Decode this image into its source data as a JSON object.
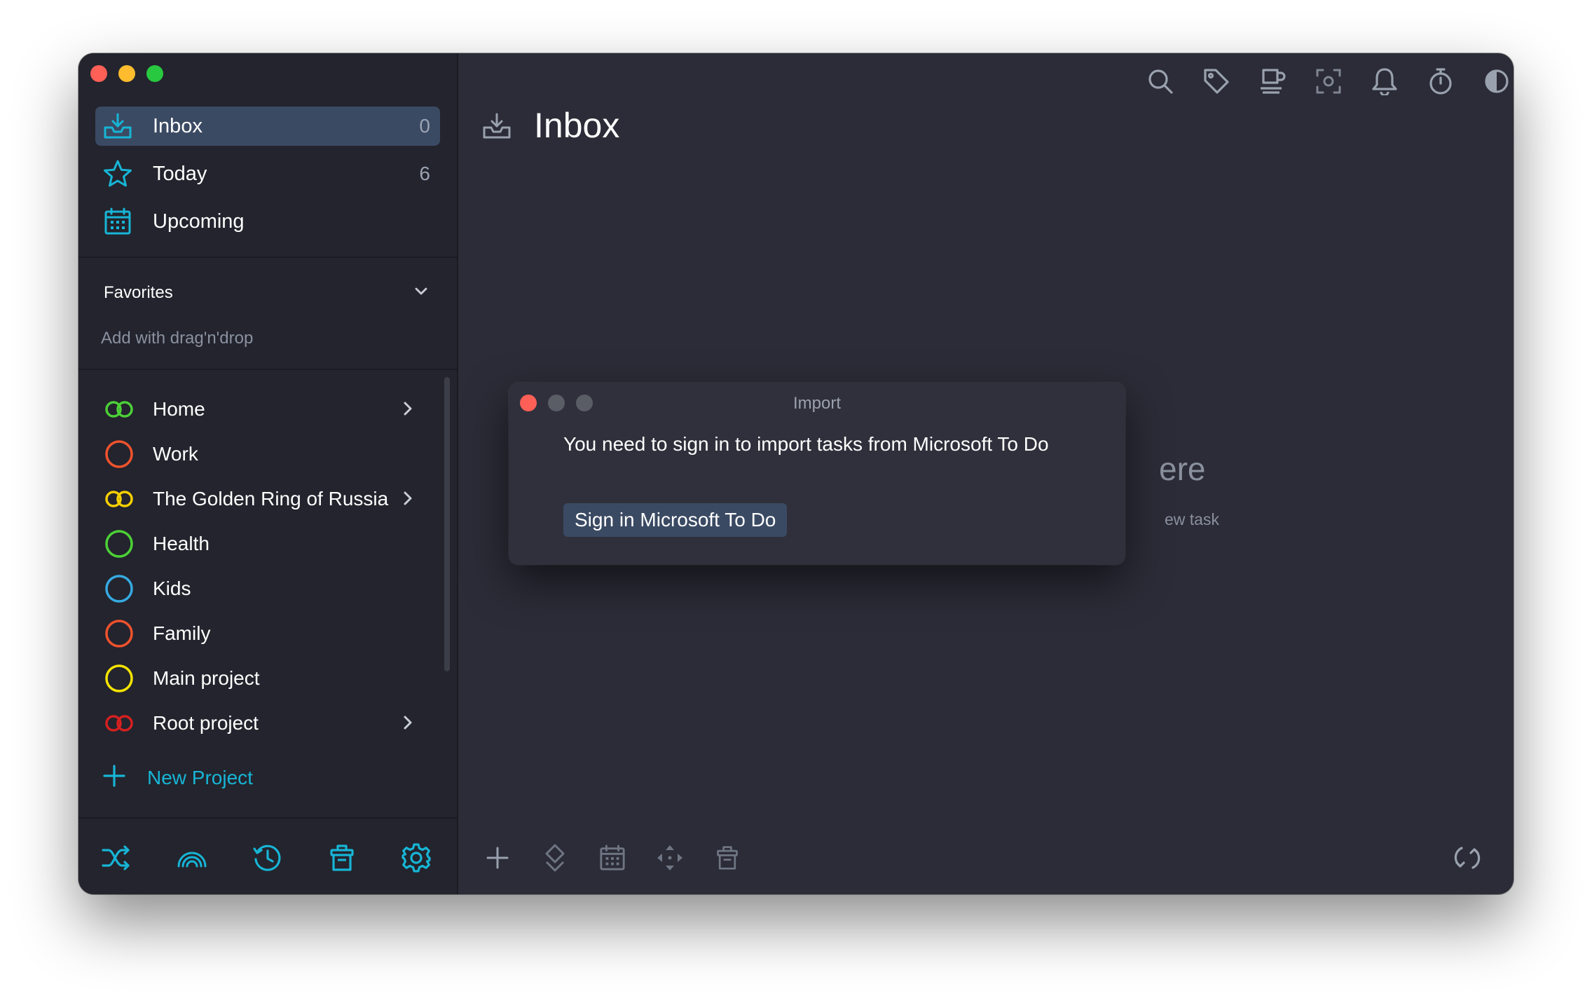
{
  "sidebar": {
    "nav": [
      {
        "label": "Inbox",
        "count": "0"
      },
      {
        "label": "Today",
        "count": "6"
      },
      {
        "label": "Upcoming",
        "count": ""
      }
    ],
    "favorites": {
      "title": "Favorites",
      "hint": "Add with drag'n'drop"
    },
    "projects": [
      {
        "label": "Home",
        "color": "#4cd137",
        "has_children": true
      },
      {
        "label": "Work",
        "color": "#f0522d",
        "has_children": false
      },
      {
        "label": "The Golden Ring of Russia",
        "color": "#f5d000",
        "has_children": true
      },
      {
        "label": "Health",
        "color": "#4cd137",
        "has_children": false
      },
      {
        "label": "Kids",
        "color": "#36a9e1",
        "has_children": false
      },
      {
        "label": "Family",
        "color": "#f0522d",
        "has_children": false
      },
      {
        "label": "Main project",
        "color": "#f5e400",
        "has_children": false
      },
      {
        "label": "Root project",
        "color": "#d62020",
        "has_children": true
      }
    ],
    "new_project_label": "New Project",
    "bottom_icons": [
      "shuffle-icon",
      "focus-icon",
      "history-icon",
      "trash-icon",
      "settings-icon"
    ]
  },
  "main": {
    "title": "Inbox",
    "toolbar_icons": [
      "search-icon",
      "tag-icon",
      "coffee-icon",
      "focus-frame-icon",
      "bell-icon",
      "timer-icon",
      "theme-icon",
      "windows-icon"
    ],
    "empty_title_fragment": "ere",
    "empty_sub_fragment": "ew task",
    "bottom_icons": [
      "add-icon",
      "priority-icon",
      "calendar-icon",
      "move-icon",
      "delete-icon",
      "sync-icon"
    ]
  },
  "dialog": {
    "title": "Import",
    "message": "You need to sign in to import tasks from Microsoft To Do",
    "button": "Sign in Microsoft To Do"
  },
  "colors": {
    "accent": "#17b5d6",
    "sidebar_bg": "#23242d",
    "main_bg": "#2b2c37",
    "selection": "#3b4a63"
  }
}
